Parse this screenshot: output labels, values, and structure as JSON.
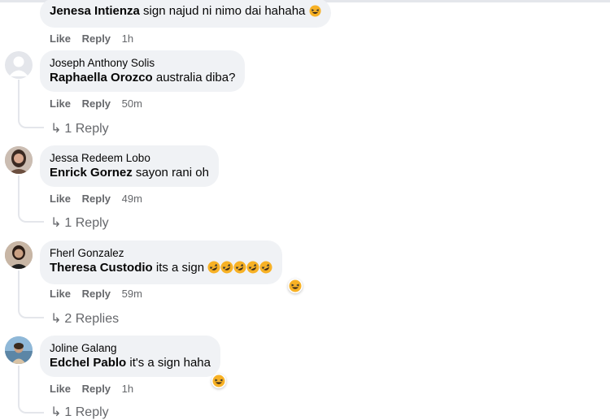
{
  "action_labels": {
    "like": "Like",
    "reply": "Reply"
  },
  "comments": [
    {
      "author": "",
      "tagged": "Jenesa Intienza",
      "text": " sign najud ni nimo dai hahaha",
      "emoji_count": 1,
      "time": "1h",
      "replies_label": ""
    },
    {
      "author": "Joseph Anthony Solis",
      "tagged": "Raphaella Orozco",
      "text": " australia diba?",
      "emoji_count": 0,
      "time": "50m",
      "replies_label": "1 Reply"
    },
    {
      "author": "Jessa Redeem Lobo",
      "tagged": "Enrick Gornez",
      "text": " sayon rani oh",
      "emoji_count": 0,
      "time": "49m",
      "replies_label": "1 Reply"
    },
    {
      "author": "Fherl Gonzalez",
      "tagged": "Theresa Custodio",
      "text": " its a sign ",
      "emoji_count": 5,
      "time": "59m",
      "replies_label": "2 Replies",
      "reaction": "haha-icon"
    },
    {
      "author": "Joline Galang",
      "tagged": "Edchel Pablo",
      "text": " it's a sign haha",
      "emoji_count": 0,
      "time": "1h",
      "replies_label": "1 Reply",
      "reaction": "haha-icon"
    }
  ],
  "colors": {
    "bubble": "#f0f2f5",
    "meta": "#65676b",
    "text": "#050505",
    "emoji_yellow": "#f7b125"
  }
}
